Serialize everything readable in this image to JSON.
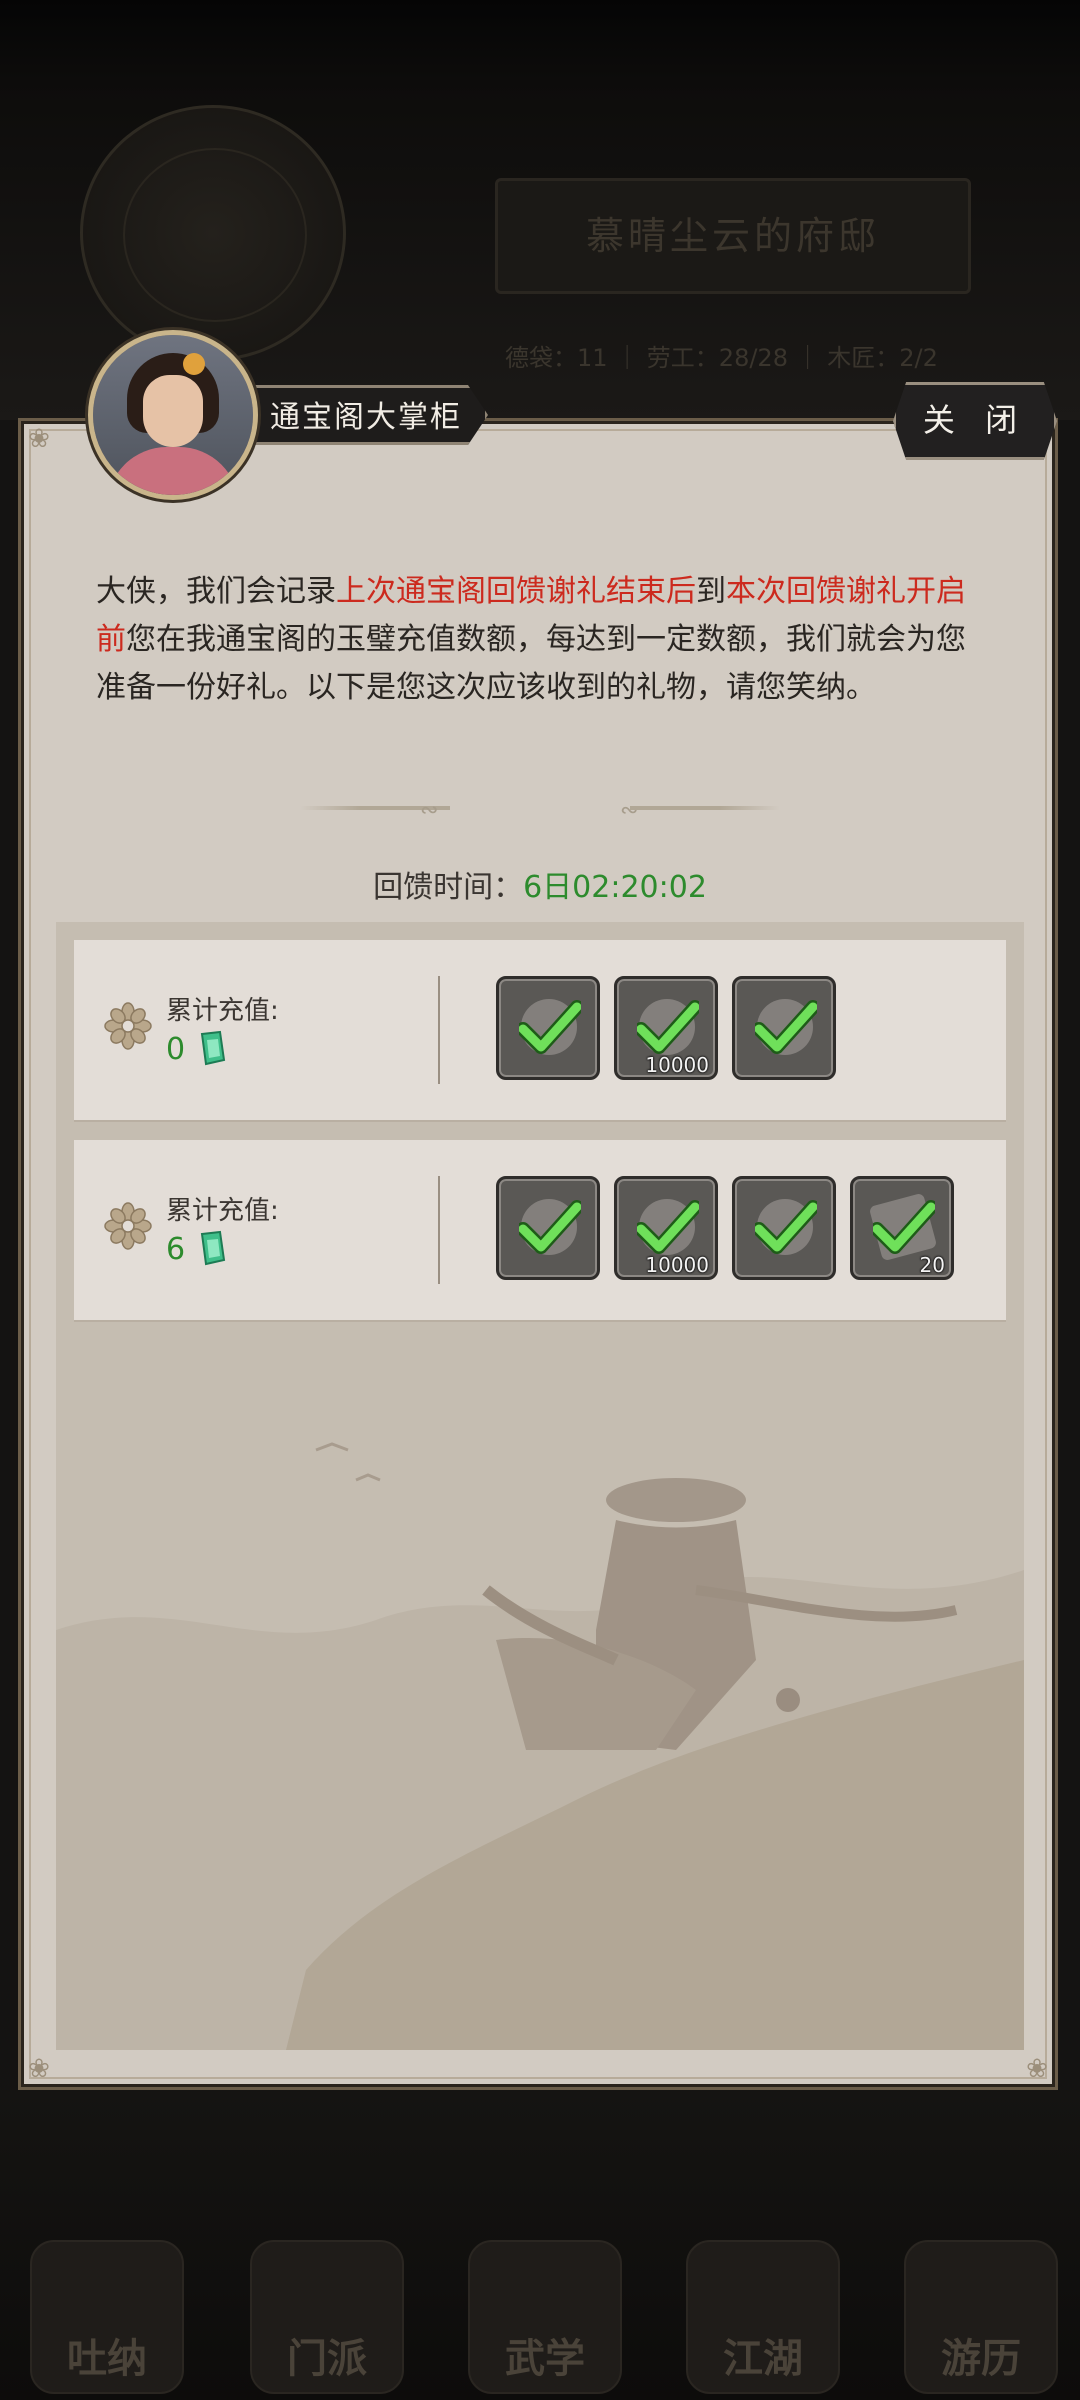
{
  "background": {
    "mansion_title": "慕晴尘云的府邸",
    "stats": "德袋：11 ｜ 劳工：28/28 ｜ 木匠：2/2",
    "nav": [
      "吐纳",
      "门派",
      "武学",
      "江湖",
      "游历"
    ]
  },
  "dialog": {
    "npc_name": "通宝阁大掌柜",
    "close_label": "关 闭",
    "intro": {
      "part1": "大侠，我们会记录",
      "part2_red": "上次通宝阁回馈谢礼结束后",
      "part3": "到",
      "part4_red": "本次回馈谢礼开启前",
      "part5": "您在我通宝阁的玉璧充值数额，每达到一定数额，我们就会为您准备一份好礼。以下是您这次应该收到的礼物，请您笑纳。"
    },
    "timer_label": "回馈时间：",
    "timer_value": "6日02:20:02",
    "tiers": [
      {
        "label": "累计充值:",
        "amount": "0",
        "rewards": [
          {
            "icon": "pouch-icon",
            "qty": "",
            "claimed": true
          },
          {
            "icon": "coin-icon",
            "qty": "10000",
            "claimed": true
          },
          {
            "icon": "scroll-icon",
            "qty": "",
            "claimed": true
          }
        ]
      },
      {
        "label": "累计充值:",
        "amount": "6",
        "rewards": [
          {
            "icon": "pouch-icon",
            "qty": "",
            "claimed": true
          },
          {
            "icon": "coin-icon",
            "qty": "10000",
            "claimed": true
          },
          {
            "icon": "scroll-icon",
            "qty": "",
            "claimed": true
          },
          {
            "icon": "token-icon",
            "qty": "20",
            "claimed": true
          }
        ]
      }
    ]
  },
  "colors": {
    "accent_red": "#cc2a1e",
    "value_green": "#2d8b2d",
    "check_green": "#6fe05a"
  }
}
